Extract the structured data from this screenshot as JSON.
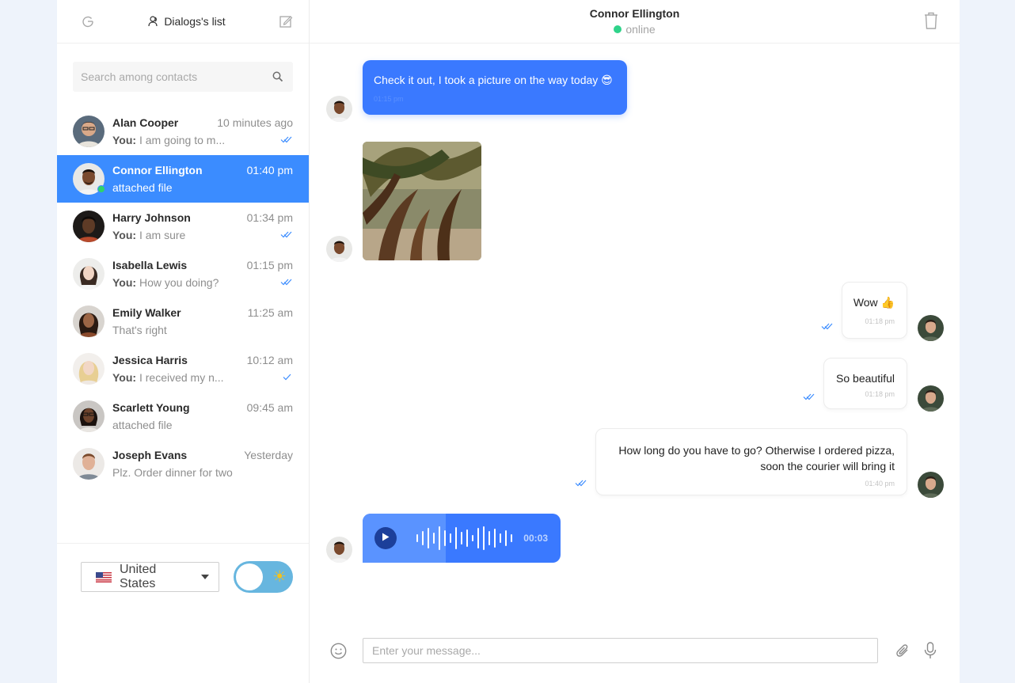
{
  "sidebar": {
    "title": "Dialogs's list",
    "search_placeholder": "Search among contacts",
    "dialogs": [
      {
        "name": "Alan Cooper",
        "time": "10 minutes ago",
        "prefix": "You: ",
        "message": "I am going to m...",
        "read_status": "read"
      },
      {
        "name": "Connor Ellington",
        "time": "01:40 pm",
        "prefix": "",
        "message": "attached file",
        "active": true,
        "online": true
      },
      {
        "name": "Harry Johnson",
        "time": "01:34 pm",
        "prefix": "You: ",
        "message": "I am sure",
        "read_status": "read"
      },
      {
        "name": "Isabella Lewis",
        "time": "01:15 pm",
        "prefix": "You: ",
        "message": "How you doing?",
        "read_status": "read"
      },
      {
        "name": "Emily Walker",
        "time": "11:25 am",
        "prefix": "",
        "message": "That's right"
      },
      {
        "name": "Jessica Harris",
        "time": "10:12 am",
        "prefix": "You: ",
        "message": "I received my n...",
        "read_status": "sent"
      },
      {
        "name": "Scarlett Young",
        "time": "09:45 am",
        "prefix": "",
        "message": "attached file"
      },
      {
        "name": "Joseph Evans",
        "time": "Yesterday",
        "prefix": "",
        "message": "Plz. Order dinner for two"
      }
    ],
    "language": "United States",
    "theme_toggle_icon": "sun-icon"
  },
  "chat": {
    "contact_name": "Connor Ellington",
    "status": "online",
    "messages": [
      {
        "direction": "in",
        "type": "text",
        "text": "Check it out, I took a picture on the way today 😎",
        "time": "01:15 pm"
      },
      {
        "direction": "in",
        "type": "image"
      },
      {
        "direction": "out",
        "type": "text",
        "text": "Wow 👍",
        "time": "01:18 pm"
      },
      {
        "direction": "out",
        "type": "text",
        "text": "So beautiful",
        "time": "01:18 pm"
      },
      {
        "direction": "out",
        "type": "text",
        "text": "How long do you have to go? Otherwise I ordered pizza, soon the courier will bring it",
        "time": "01:40 pm"
      },
      {
        "direction": "in",
        "type": "voice",
        "duration": "00:03",
        "progress": 0.42
      }
    ],
    "input_placeholder": "Enter your message..."
  },
  "colors": {
    "accent": "#3b8cff",
    "bubble_in": "#3a79ff",
    "online": "#2fd38a"
  }
}
